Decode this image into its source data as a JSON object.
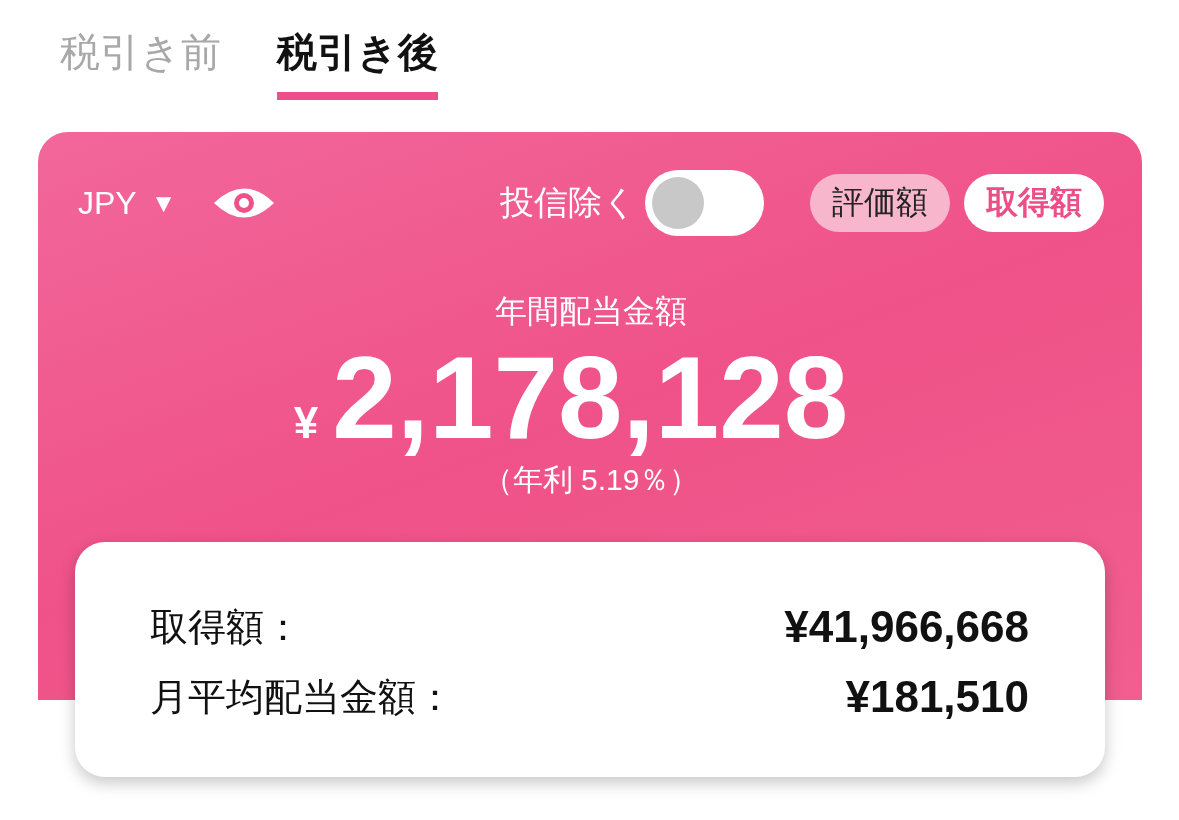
{
  "tabs": [
    {
      "label": "税引き前",
      "selected": false
    },
    {
      "label": "税引き後",
      "selected": true
    }
  ],
  "card": {
    "currency": "JPY",
    "currency_caret": "▼",
    "exclude_funds": {
      "label": "投信除く",
      "on": false
    },
    "basis_buttons": [
      {
        "label": "評価額",
        "selected": false
      },
      {
        "label": "取得額",
        "selected": true
      }
    ],
    "title": "年間配当金額",
    "currency_symbol": "¥",
    "amount": "2,178,128",
    "yield": "（年利 5.19％）"
  },
  "summary": [
    {
      "label": "取得額：",
      "value": "¥41,966,668"
    },
    {
      "label": "月平均配当金額：",
      "value": "¥181,510"
    }
  ]
}
